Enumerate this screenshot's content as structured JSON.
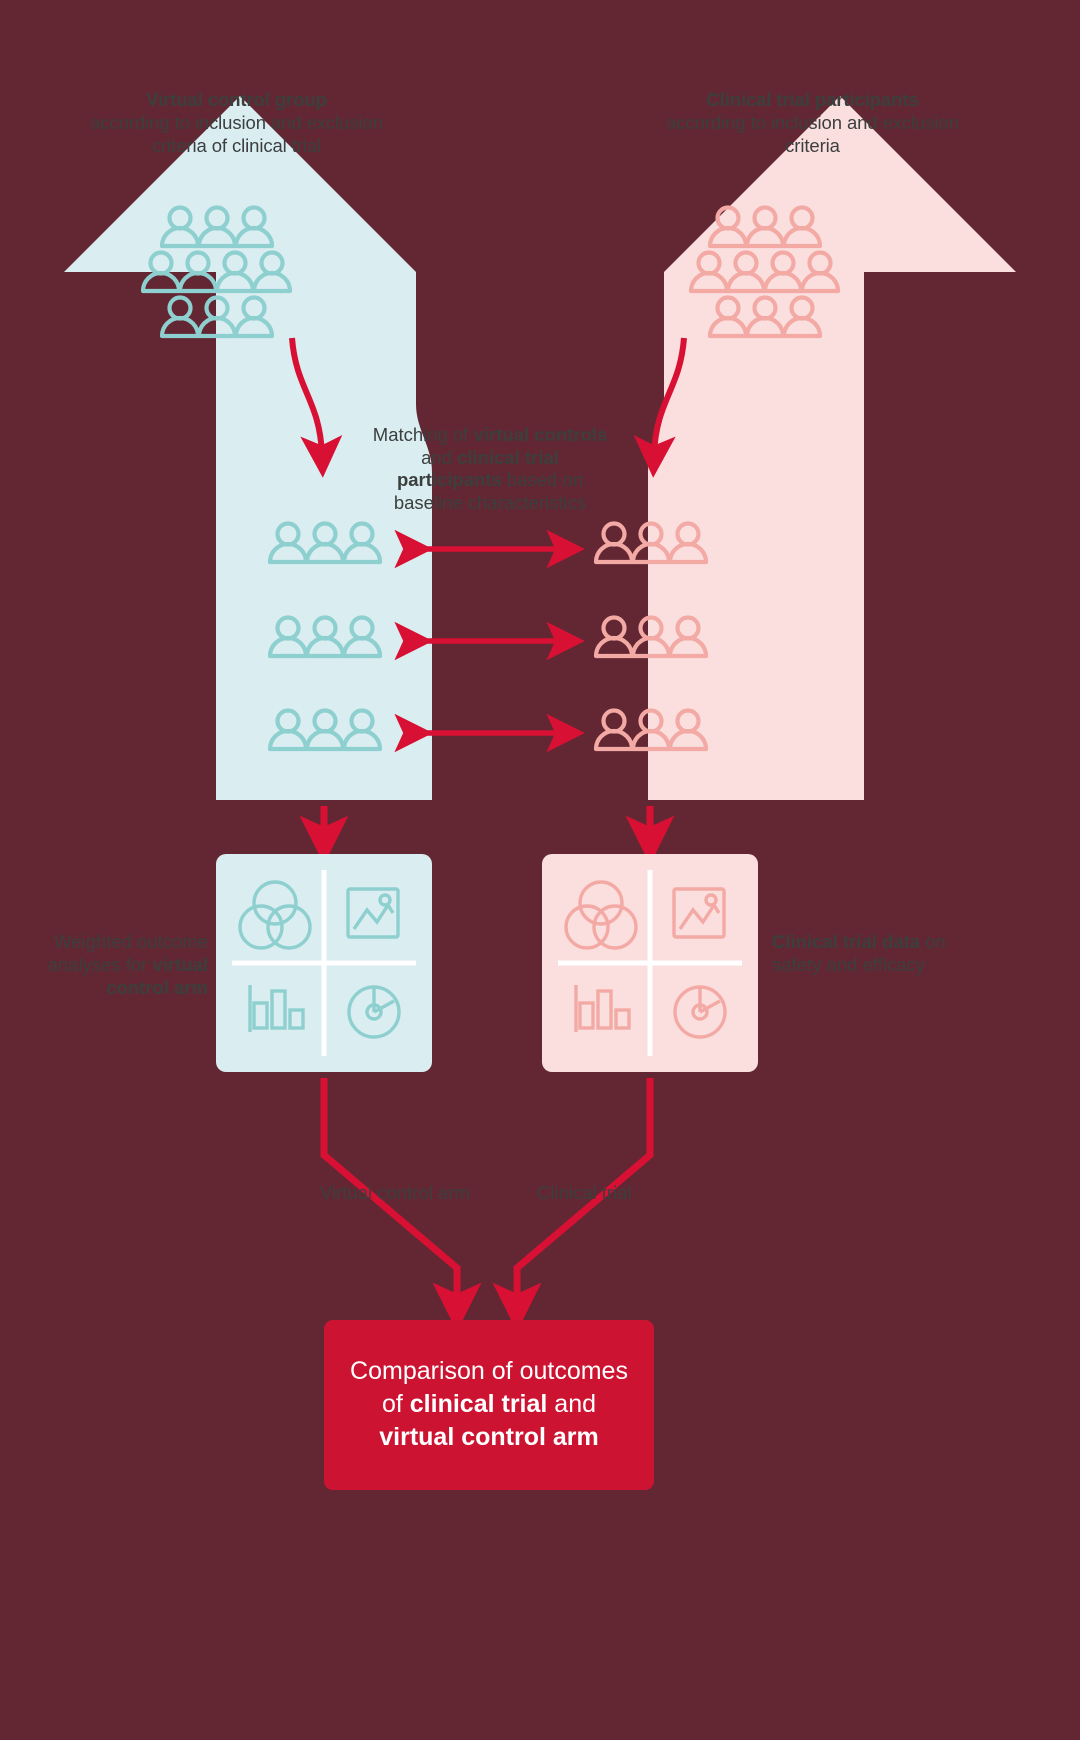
{
  "colors": {
    "background": "#632733",
    "teal_panel": "#daedf0",
    "teal_icon": "#8ecfcf",
    "pink_panel": "#fbdfdf",
    "pink_icon": "#f3a9a4",
    "accent_red": "#d81033",
    "result_box": "#cc1432",
    "dark_text": "#3b3f3e",
    "white": "#ffffff"
  },
  "titles": {
    "left": {
      "bold": "Virtual control group",
      "rest": "according to inclusion and exclusion criteria of clinical trial"
    },
    "right": {
      "bold": "Clinical trial participants",
      "rest": "according to inclusion and exclusion criteria"
    }
  },
  "matching": {
    "pre": "Matching of ",
    "bold1": "virtual controls",
    "mid": " and ",
    "bold2": "clinical trial participants",
    "post": " based on baseline characteristics"
  },
  "side_labels": {
    "left": {
      "pre": "Weighted outcome analyses for ",
      "bold": "virtual control arm"
    },
    "right": {
      "bold": "Clinical trial data",
      "post": " on safety and efficacy"
    }
  },
  "flow_labels": {
    "left": "Virtual control arm",
    "right": "Clinical trial"
  },
  "result": {
    "line1": "Comparison of outcomes",
    "line2_pre": "of ",
    "line2_bold": "clinical trial",
    "line2_post": " and",
    "line3_bold": "virtual control arm"
  },
  "icons": {
    "people_group": "people-group-icon",
    "venn": "venn-diagram-icon",
    "image_chart": "image-chart-icon",
    "bar_chart": "bar-chart-icon",
    "pie_chart": "pie-chart-icon",
    "arrow_down": "arrow-down-icon",
    "arrow_bidirectional": "bidirectional-arrow-icon"
  },
  "counts": {
    "top_people_rows": [
      3,
      4,
      3
    ],
    "matched_rows": 3,
    "people_per_matched_row": 3
  }
}
